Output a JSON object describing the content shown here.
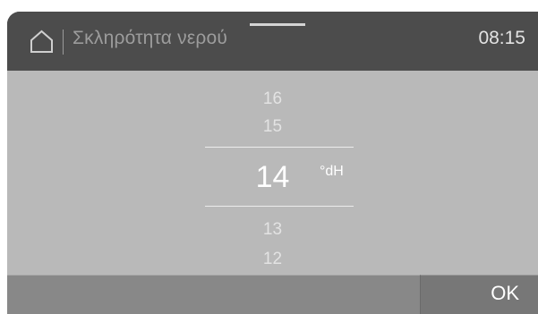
{
  "header": {
    "title": "Σκληρότητα νερού",
    "time": "08:15",
    "home_icon": "home-icon"
  },
  "picker": {
    "above": [
      "16",
      "15"
    ],
    "selected": "14",
    "unit": "°dH",
    "below": [
      "13",
      "12"
    ]
  },
  "footer": {
    "ok_label": "OK"
  },
  "colors": {
    "panel": "#4c4c4c",
    "content_bg": "#b9b9b9",
    "footer_left": "#888888",
    "ok_bg": "#777777"
  }
}
